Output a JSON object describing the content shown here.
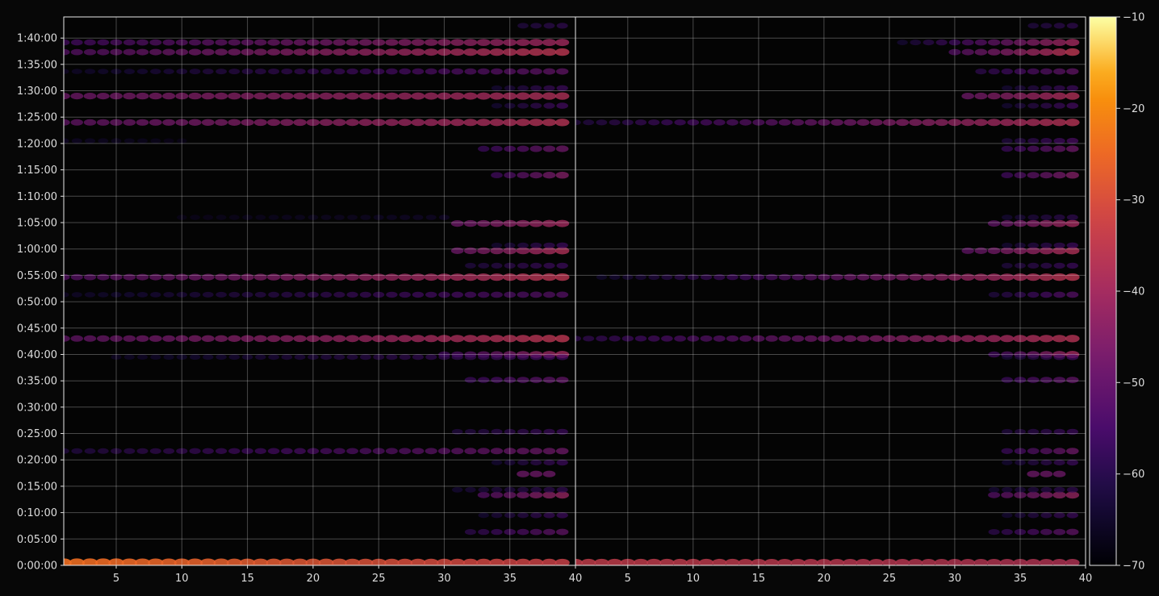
{
  "chart_data": {
    "type": "heatmap",
    "title": "",
    "xlabel": "",
    "ylabel": "",
    "grid": true,
    "background": "#070707",
    "panels": [
      {
        "name": "left",
        "xlim": [
          1,
          40
        ],
        "xticks": [
          "5",
          "10",
          "15",
          "20",
          "25",
          "30",
          "35",
          "40"
        ],
        "xtick_values": [
          5,
          10,
          15,
          20,
          25,
          30,
          35,
          40
        ]
      },
      {
        "name": "right",
        "xlim": [
          1,
          40
        ],
        "xticks": [
          "5",
          "10",
          "15",
          "20",
          "25",
          "30",
          "35",
          "40"
        ],
        "xtick_values": [
          5,
          10,
          15,
          20,
          25,
          30,
          35,
          40
        ]
      }
    ],
    "ylim_seconds": [
      0,
      6240
    ],
    "yticks": [
      "0:00:00",
      "0:05:00",
      "0:10:00",
      "0:15:00",
      "0:20:00",
      "0:25:00",
      "0:30:00",
      "0:35:00",
      "0:40:00",
      "0:45:00",
      "0:50:00",
      "0:55:00",
      "1:00:00",
      "1:05:00",
      "1:10:00",
      "1:15:00",
      "1:20:00",
      "1:25:00",
      "1:30:00",
      "1:35:00",
      "1:40:00"
    ],
    "ytick_seconds": [
      0,
      300,
      600,
      900,
      1200,
      1500,
      1800,
      2100,
      2400,
      2700,
      3000,
      3300,
      3600,
      3900,
      4200,
      4500,
      4800,
      5100,
      5400,
      5700,
      6000
    ],
    "colorbar": {
      "range": [
        -70,
        -10
      ],
      "ticks": [
        "−70",
        "−60",
        "−50",
        "−40",
        "−30",
        "−20",
        "−10"
      ],
      "tick_values": [
        -70,
        -60,
        -50,
        -40,
        -30,
        -20,
        -10
      ],
      "colormap": "inferno"
    },
    "bands": [
      {
        "t": 30,
        "left": {
          "from": 1,
          "to": 39,
          "v0": -24,
          "v1": -33
        },
        "right": {
          "from": 1,
          "to": 39,
          "v0": -34,
          "v1": -37
        }
      },
      {
        "t": 2580,
        "left": {
          "from": 1,
          "to": 39,
          "v0": -50,
          "v1": -36
        },
        "right": {
          "from": 1,
          "to": 39,
          "v0": -58,
          "v1": -37
        }
      },
      {
        "t": 3280,
        "left": {
          "from": 1,
          "to": 39,
          "v0": -52,
          "v1": -36
        },
        "right": {
          "from": 3,
          "to": 39,
          "v0": -63,
          "v1": -36
        }
      },
      {
        "t": 3580,
        "left": {
          "from": 31,
          "to": 39,
          "v0": -48,
          "v1": -38
        },
        "right": {
          "from": 31,
          "to": 39,
          "v0": -50,
          "v1": -38
        }
      },
      {
        "t": 5040,
        "left": {
          "from": 1,
          "to": 39,
          "v0": -50,
          "v1": -37
        },
        "right": {
          "from": 1,
          "to": 39,
          "v0": -60,
          "v1": -37
        }
      },
      {
        "t": 5340,
        "left": {
          "from": 1,
          "to": 39,
          "v0": -48,
          "v1": -38
        },
        "right": {
          "from": 31,
          "to": 39,
          "v0": -48,
          "v1": -38
        }
      },
      {
        "t": 5840,
        "left": {
          "from": 1,
          "to": 39,
          "v0": -52,
          "v1": -36
        },
        "right": {
          "from": 30,
          "to": 39,
          "v0": -52,
          "v1": -36
        }
      },
      {
        "t": 5950,
        "left": {
          "from": 1,
          "to": 39,
          "v0": -55,
          "v1": -40
        },
        "right": {
          "from": 26,
          "to": 39,
          "v0": -62,
          "v1": -40
        }
      },
      {
        "t": 3890,
        "left": {
          "from": 31,
          "to": 39,
          "v0": -48,
          "v1": -40
        },
        "right": {
          "from": 33,
          "to": 39,
          "v0": -50,
          "v1": -40
        }
      },
      {
        "t": 2400,
        "left": {
          "from": 30,
          "to": 39,
          "v0": -55,
          "v1": -40
        },
        "right": {
          "from": 33,
          "to": 39,
          "v0": -55,
          "v1": -40
        }
      },
      {
        "t": 800,
        "left": {
          "from": 33,
          "to": 39,
          "v0": -52,
          "v1": -42
        },
        "right": {
          "from": 33,
          "to": 39,
          "v0": -52,
          "v1": -42
        }
      },
      {
        "t": 4440,
        "left": {
          "from": 34,
          "to": 39,
          "v0": -55,
          "v1": -45
        },
        "right": {
          "from": 34,
          "to": 39,
          "v0": -55,
          "v1": -45
        }
      },
      {
        "t": 4740,
        "left": {
          "from": 33,
          "to": 39,
          "v0": -56,
          "v1": -48
        },
        "right": {
          "from": 34,
          "to": 39,
          "v0": -56,
          "v1": -48
        }
      },
      {
        "t": 1300,
        "left": {
          "from": 1,
          "to": 39,
          "v0": -60,
          "v1": -48
        },
        "right": {
          "from": 34,
          "to": 39,
          "v0": -56,
          "v1": -48
        }
      },
      {
        "t": 2110,
        "left": {
          "from": 32,
          "to": 39,
          "v0": -56,
          "v1": -50
        },
        "right": {
          "from": 34,
          "to": 39,
          "v0": -56,
          "v1": -50
        }
      },
      {
        "t": 380,
        "left": {
          "from": 32,
          "to": 39,
          "v0": -58,
          "v1": -50
        },
        "right": {
          "from": 33,
          "to": 39,
          "v0": -58,
          "v1": -50
        }
      },
      {
        "t": 5620,
        "left": {
          "from": 1,
          "to": 39,
          "v0": -64,
          "v1": -50
        },
        "right": {
          "from": 32,
          "to": 39,
          "v0": -58,
          "v1": -50
        }
      },
      {
        "t": 2370,
        "left": {
          "from": 5,
          "to": 39,
          "v0": -64,
          "v1": -55
        },
        "right": {
          "from": 34,
          "to": 39,
          "v0": -62,
          "v1": -55
        }
      },
      {
        "t": 3080,
        "left": {
          "from": 1,
          "to": 39,
          "v0": -64,
          "v1": -52
        },
        "right": {
          "from": 33,
          "to": 39,
          "v0": -60,
          "v1": -52
        }
      },
      {
        "t": 4830,
        "left": {
          "from": 1,
          "to": 10,
          "v0": -64,
          "v1": -66
        },
        "right": {
          "from": 34,
          "to": 39,
          "v0": -60,
          "v1": -54
        }
      },
      {
        "t": 1040,
        "left": {
          "from": 36,
          "to": 38,
          "v0": -48,
          "v1": -48
        },
        "right": {
          "from": 36,
          "to": 38,
          "v0": -48,
          "v1": -48
        }
      },
      {
        "t": 860,
        "left": {
          "from": 31,
          "to": 39,
          "v0": -62,
          "v1": -58
        },
        "right": {
          "from": 33,
          "to": 39,
          "v0": -62,
          "v1": -58
        }
      },
      {
        "t": 3410,
        "left": {
          "from": 32,
          "to": 39,
          "v0": -60,
          "v1": -56
        },
        "right": {
          "from": 34,
          "to": 39,
          "v0": -60,
          "v1": -56
        }
      },
      {
        "t": 3640,
        "left": {
          "from": 34,
          "to": 39,
          "v0": -62,
          "v1": -56
        },
        "right": {
          "from": 34,
          "to": 39,
          "v0": -62,
          "v1": -56
        }
      },
      {
        "t": 6140,
        "left": {
          "from": 36,
          "to": 39,
          "v0": -60,
          "v1": -58
        },
        "right": {
          "from": 36,
          "to": 39,
          "v0": -60,
          "v1": -58
        }
      },
      {
        "t": 570,
        "left": {
          "from": 33,
          "to": 39,
          "v0": -62,
          "v1": -56
        },
        "right": {
          "from": 34,
          "to": 39,
          "v0": -62,
          "v1": -56
        }
      },
      {
        "t": 1170,
        "left": {
          "from": 34,
          "to": 39,
          "v0": -62,
          "v1": -56
        },
        "right": {
          "from": 34,
          "to": 39,
          "v0": -62,
          "v1": -56
        }
      },
      {
        "t": 1520,
        "left": {
          "from": 31,
          "to": 39,
          "v0": -60,
          "v1": -56
        },
        "right": {
          "from": 34,
          "to": 39,
          "v0": -60,
          "v1": -56
        }
      },
      {
        "t": 5230,
        "left": {
          "from": 34,
          "to": 39,
          "v0": -62,
          "v1": -55
        },
        "right": {
          "from": 34,
          "to": 39,
          "v0": -62,
          "v1": -55
        }
      },
      {
        "t": 5430,
        "left": {
          "from": 34,
          "to": 39,
          "v0": -62,
          "v1": -56
        },
        "right": {
          "from": 34,
          "to": 39,
          "v0": -62,
          "v1": -56
        }
      },
      {
        "t": 3960,
        "left": {
          "from": 10,
          "to": 30,
          "v0": -66,
          "v1": -64
        },
        "right": {
          "from": 34,
          "to": 39,
          "v0": -62,
          "v1": -58
        }
      }
    ]
  }
}
